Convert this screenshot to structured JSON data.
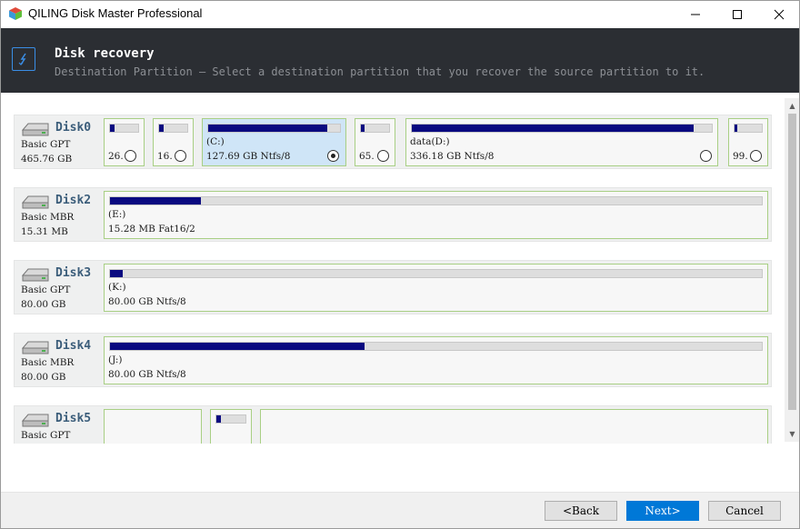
{
  "window": {
    "title": "QILING Disk Master Professional",
    "icons": {
      "app": "cube-icon",
      "minimize": "minimize-icon",
      "maximize": "maximize-icon",
      "close": "close-icon"
    }
  },
  "header": {
    "title": "Disk recovery",
    "subtitle": "Destination Partition — Select a destination partition that you recover the source partition to it.",
    "icon": "disk-recovery-icon"
  },
  "disks": [
    {
      "name": "Disk0",
      "type": "Basic GPT",
      "size": "465.76 GB",
      "partitions": [
        {
          "label": "",
          "info": "26.",
          "usage": 0.15,
          "selected": false
        },
        {
          "label": "",
          "info": "16.",
          "usage": 0.15,
          "selected": false
        },
        {
          "label": "(C:)",
          "info": "127.69 GB Ntfs/8",
          "usage": 0.9,
          "selected": true
        },
        {
          "label": "",
          "info": "65.",
          "usage": 0.12,
          "selected": false
        },
        {
          "label": "data(D:)",
          "info": "336.18 GB Ntfs/8",
          "usage": 0.94,
          "selected": false
        },
        {
          "label": "",
          "info": "99.",
          "usage": 0.1,
          "selected": false
        }
      ]
    },
    {
      "name": "Disk2",
      "type": "Basic MBR",
      "size": "15.31 MB",
      "partitions": [
        {
          "label": "(E:)",
          "info": "15.28 MB Fat16/2",
          "usage": 0.14,
          "selected": false
        }
      ]
    },
    {
      "name": "Disk3",
      "type": "Basic GPT",
      "size": "80.00 GB",
      "partitions": [
        {
          "label": "(K:)",
          "info": "80.00 GB Ntfs/8",
          "usage": 0.02,
          "selected": false
        }
      ]
    },
    {
      "name": "Disk4",
      "type": "Basic MBR",
      "size": "80.00 GB",
      "partitions": [
        {
          "label": "(J:)",
          "info": "80.00 GB Ntfs/8",
          "usage": 0.39,
          "selected": false
        }
      ]
    },
    {
      "name": "Disk5",
      "type": "Basic GPT",
      "size": "",
      "partitions": [
        {
          "label": "",
          "info": "",
          "usage": null,
          "selected": false
        },
        {
          "label": "",
          "info": "",
          "usage": 0.15,
          "selected": false
        },
        {
          "label": "",
          "info": "",
          "usage": null,
          "selected": false
        }
      ]
    }
  ],
  "buttons": {
    "back": "<Back",
    "next": "Next>",
    "cancel": "Cancel"
  },
  "colors": {
    "header_bg": "#2b2e33",
    "usage_fill": "#0a0a80",
    "partition_border": "#a8cf84",
    "selected_bg": "#cfe5f7",
    "next_button": "#0078d7"
  }
}
